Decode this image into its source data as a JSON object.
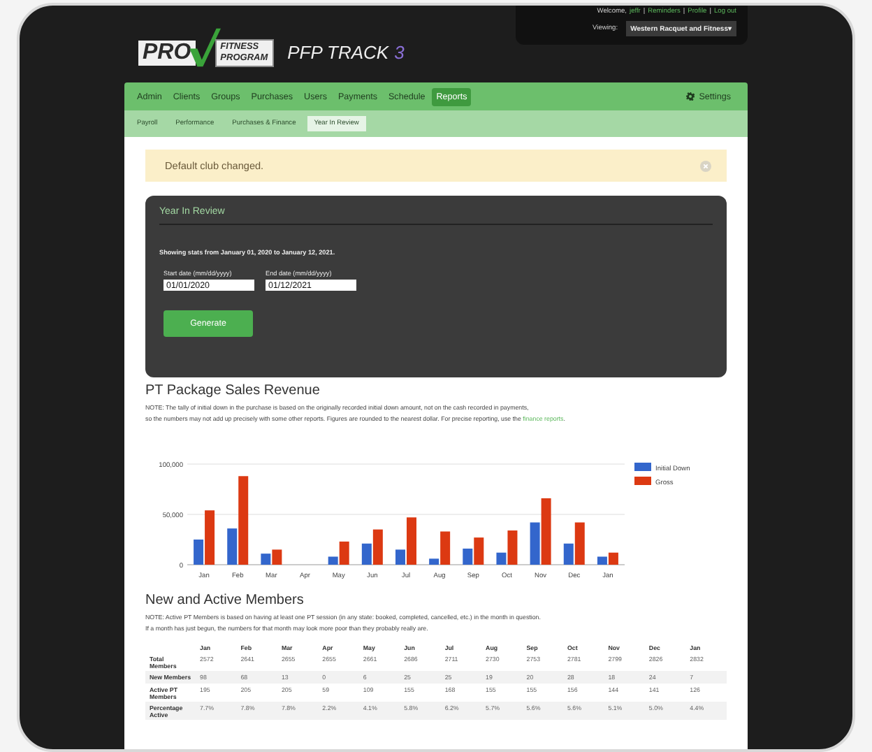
{
  "logo": {
    "word": "PRO",
    "line_1": "FITNESS",
    "line_2": "PROGRAM"
  },
  "app": {
    "name": "PFP TRACK",
    "version": "3"
  },
  "account": {
    "welcome": "Welcome,",
    "user": "jeffr",
    "links": [
      {
        "separator": "|",
        "label": "Reminders"
      },
      {
        "separator": "|",
        "label": "Profile"
      },
      {
        "separator": "|",
        "label": "Log out"
      }
    ],
    "viewing_label": "Viewing:",
    "club": "Western Racquet and Fitness▾"
  },
  "nav": {
    "items": [
      {
        "label": "Admin",
        "selected": false
      },
      {
        "label": "Clients",
        "selected": false
      },
      {
        "label": "Groups",
        "selected": false
      },
      {
        "label": "Purchases",
        "selected": false
      },
      {
        "label": "Users",
        "selected": false
      },
      {
        "label": "Payments",
        "selected": false
      },
      {
        "label": "Schedule",
        "selected": false
      },
      {
        "label": "Reports",
        "selected": true
      }
    ],
    "settings": "Settings"
  },
  "subnav": {
    "items": [
      {
        "label": "Payroll",
        "selected": false
      },
      {
        "label": "Performance",
        "selected": false
      },
      {
        "label": "Purchases & Finance",
        "selected": false
      },
      {
        "label": "Year In Review",
        "selected": true
      }
    ]
  },
  "alert": {
    "message": "Default club changed."
  },
  "card": {
    "title": "Year In Review",
    "summary": "Showing stats from January 01, 2020 to January 12, 2021.",
    "fields": [
      {
        "label": "Start date (mm/dd/yyyy)",
        "value": "01/01/2020"
      },
      {
        "label": "End date (mm/dd/yyyy)",
        "value": "01/12/2021"
      }
    ],
    "button": "Generate"
  },
  "revenue": {
    "title": "PT Package Sales Revenue",
    "note_1": "NOTE: The tally of initial down in the purchase is based on the originally recorded initial down amount, not on the cash recorded in payments,",
    "note_2": "so the numbers may not add up precisely with some other reports. Figures are rounded to the nearest dollar. For precise reporting, use the",
    "note_link": "finance reports",
    "note_end": ".",
    "chart_data": {
      "type": "bar",
      "legend": true,
      "categories": [
        "Jan",
        "Feb",
        "Mar",
        "Apr",
        "May",
        "Jun",
        "Jul",
        "Aug",
        "Sep",
        "Oct",
        "Nov",
        "Dec",
        "Jan"
      ],
      "ylim": [
        0,
        100000
      ],
      "yticks": [
        {
          "value": 0,
          "label": "0"
        },
        {
          "value": 50000,
          "label": "50,000"
        },
        {
          "value": 100000,
          "label": "100,000"
        }
      ],
      "series": [
        {
          "name": "Initial Down",
          "color": "#3366cc",
          "values": [
            25000,
            36000,
            11000,
            0,
            8000,
            21000,
            15000,
            6000,
            16000,
            12000,
            42000,
            21000,
            8000
          ]
        },
        {
          "name": "Gross",
          "color": "#dc3912",
          "values": [
            54000,
            88000,
            15000,
            0,
            23000,
            35000,
            47000,
            33000,
            27000,
            34000,
            66000,
            42000,
            12000
          ]
        }
      ]
    }
  },
  "members": {
    "title": "New and Active Members",
    "note_1": "NOTE: Active PT Members is based on having at least one PT session (in any state: booked, completed, cancelled, etc.) in the month in question.",
    "note_2": "If a month has just begun, the numbers for that month may look more poor than they probably really are.",
    "table": {
      "columns": [
        "Jan",
        "Feb",
        "Mar",
        "Apr",
        "May",
        "Jun",
        "Jul",
        "Aug",
        "Sep",
        "Oct",
        "Nov",
        "Dec",
        "Jan"
      ],
      "rows": [
        {
          "label": "Total Members",
          "cells": [
            "2572",
            "2641",
            "2655",
            "2655",
            "2661",
            "2686",
            "2711",
            "2730",
            "2753",
            "2781",
            "2799",
            "2826",
            "2832"
          ]
        },
        {
          "label": "New Members",
          "cells": [
            "98",
            "68",
            "13",
            "0",
            "6",
            "25",
            "25",
            "19",
            "20",
            "28",
            "18",
            "24",
            "7"
          ]
        },
        {
          "label": "Active PT Members",
          "cells": [
            "195",
            "205",
            "205",
            "59",
            "109",
            "155",
            "168",
            "155",
            "155",
            "156",
            "144",
            "141",
            "126"
          ]
        },
        {
          "label": "Percentage Active",
          "cells": [
            "7.7%",
            "7.8%",
            "7.8%",
            "2.2%",
            "4.1%",
            "5.8%",
            "6.2%",
            "5.7%",
            "5.6%",
            "5.6%",
            "5.1%",
            "5.0%",
            "4.4%"
          ]
        }
      ]
    }
  }
}
